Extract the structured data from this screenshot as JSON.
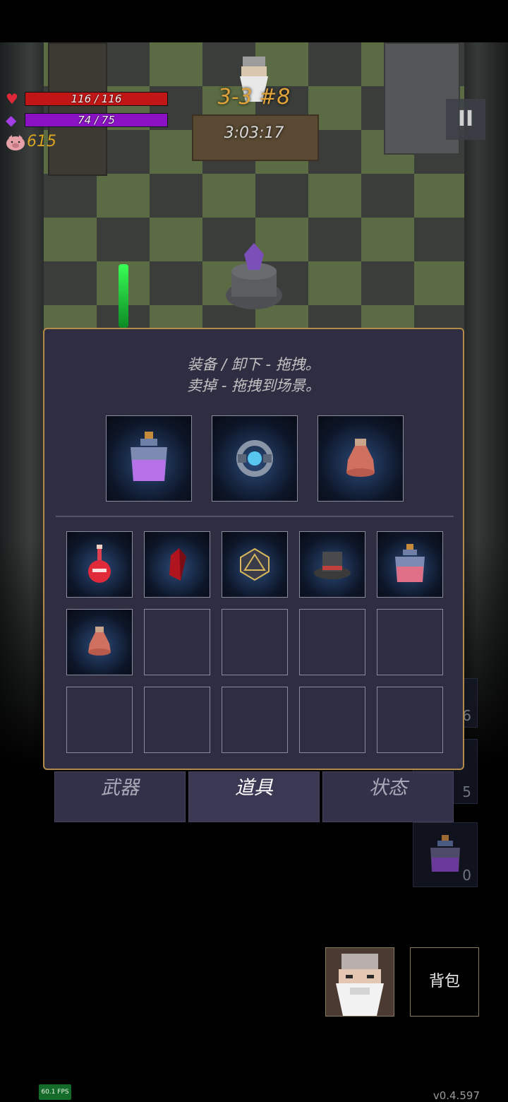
{
  "hud": {
    "hp_text": "116 / 116",
    "hp_fill": 1.0,
    "mp_text": "74 / 75",
    "mp_fill": 0.987,
    "coins": "615",
    "level": "3-3 #8",
    "timer": "3:03:17",
    "pause_symbol": "II",
    "hp_color": "#c01616",
    "mp_color": "#8a12c4",
    "coin_color": "#d9a521"
  },
  "inventory": {
    "hint_line1": "装备 / 卸下 - 拖拽。",
    "hint_line2": "卖掉 - 拖拽到场景。",
    "equipped": [
      {
        "icon": "purple-potion-jar-icon"
      },
      {
        "icon": "blue-crystal-ring-icon"
      },
      {
        "icon": "red-vase-icon"
      }
    ],
    "grid": [
      {
        "icon": "red-flask-icon"
      },
      {
        "icon": "red-crystal-icon"
      },
      {
        "icon": "golden-d20-icon"
      },
      {
        "icon": "top-hat-icon"
      },
      {
        "icon": "pink-potion-jar-icon"
      },
      {
        "icon": "red-vase-icon"
      },
      {
        "icon": ""
      },
      {
        "icon": ""
      },
      {
        "icon": ""
      },
      {
        "icon": ""
      },
      {
        "icon": ""
      },
      {
        "icon": ""
      },
      {
        "icon": ""
      },
      {
        "icon": ""
      },
      {
        "icon": ""
      }
    ]
  },
  "tabs": {
    "weapons": "武器",
    "items": "道具",
    "status": "状态",
    "active": "items"
  },
  "quick_slots": {
    "count_1": "6",
    "count_2": "5",
    "count_3": "0"
  },
  "bottom": {
    "backpack_label": "背包",
    "fps": "60.1 FPS",
    "version": "v0.4.597"
  },
  "colors": {
    "panel_bg": "#2f2d42",
    "panel_border": "#b48a4a"
  }
}
